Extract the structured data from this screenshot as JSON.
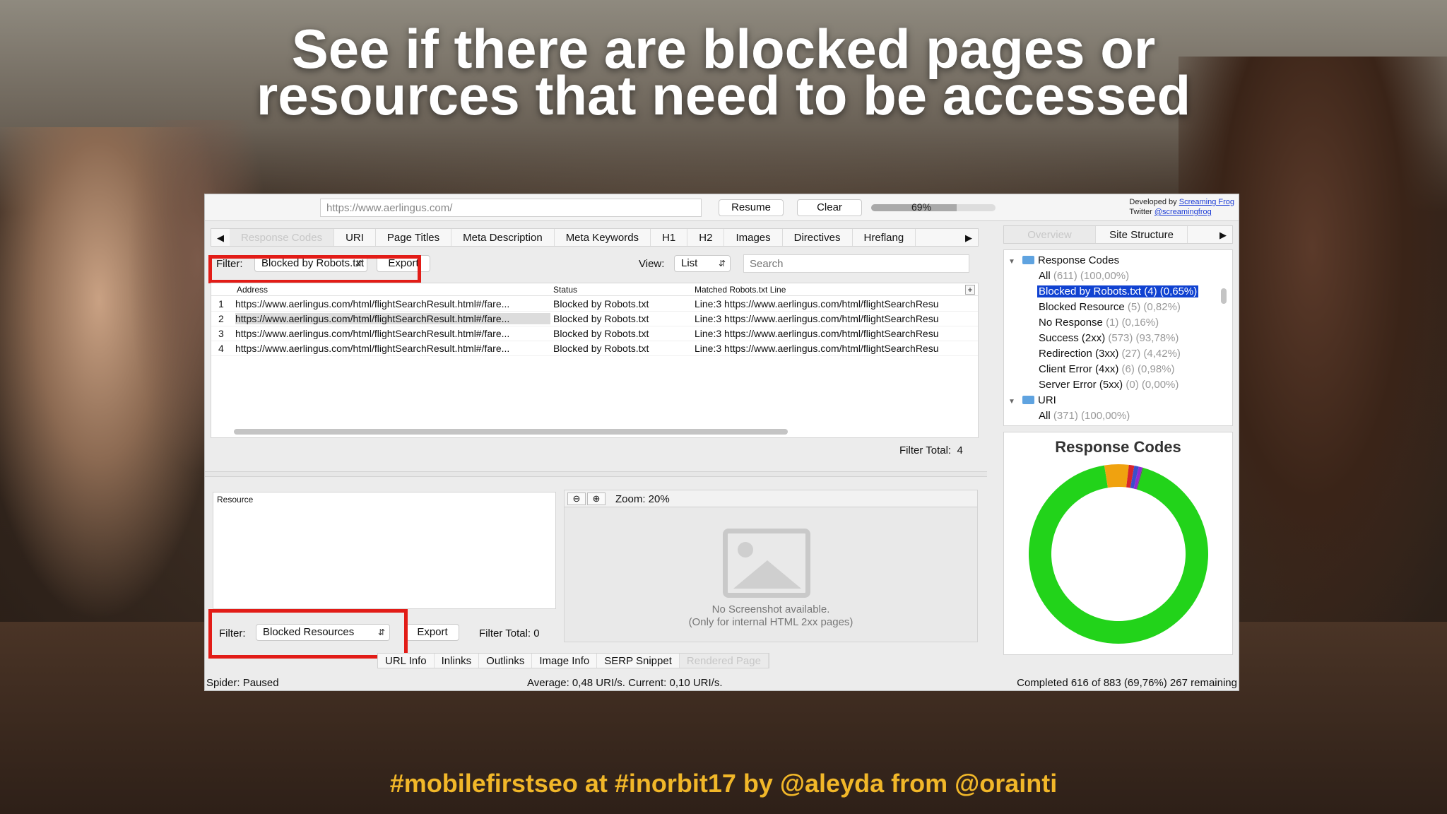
{
  "slide": {
    "headline_line1": "See if there are blocked pages or",
    "headline_line2": "resources that need to be accessed",
    "footer": "#mobilefirstseo at #inorbit17 by @aleyda from @orainti"
  },
  "toolbar": {
    "url_value": "https://www.aerlingus.com/",
    "resume_label": "Resume",
    "clear_label": "Clear",
    "progress_label": "69%",
    "progress_fraction": 0.69,
    "developed_by_prefix": "Developed by ",
    "developed_by_link": "Screaming Frog",
    "twitter_prefix": "Twitter ",
    "twitter_link": "@screamingfrog"
  },
  "tabs": {
    "prev_icon": "◀",
    "next_icon": "▶",
    "items": [
      "Response Codes",
      "URI",
      "Page Titles",
      "Meta Description",
      "Meta Keywords",
      "H1",
      "H2",
      "Images",
      "Directives",
      "Hreflang"
    ]
  },
  "filter": {
    "label": "Filter:",
    "value": "Blocked by Robots.txt",
    "export_label": "Export",
    "view_label": "View:",
    "view_value": "List",
    "search_placeholder": "Search"
  },
  "table": {
    "columns": [
      "Address",
      "Status",
      "Matched Robots.txt Line"
    ],
    "rows": [
      {
        "n": "1",
        "address": "https://www.aerlingus.com/html/flightSearchResult.html#/fare...",
        "status": "Blocked by Robots.txt",
        "line": "Line:3  https://www.aerlingus.com/html/flightSearchResu"
      },
      {
        "n": "2",
        "address": "https://www.aerlingus.com/html/flightSearchResult.html#/fare...",
        "status": "Blocked by Robots.txt",
        "line": "Line:3  https://www.aerlingus.com/html/flightSearchResu"
      },
      {
        "n": "3",
        "address": "https://www.aerlingus.com/html/flightSearchResult.html#/fare...",
        "status": "Blocked by Robots.txt",
        "line": "Line:3  https://www.aerlingus.com/html/flightSearchResu"
      },
      {
        "n": "4",
        "address": "https://www.aerlingus.com/html/flightSearchResult.html#/fare...",
        "status": "Blocked by Robots.txt",
        "line": "Line:3  https://www.aerlingus.com/html/flightSearchResu"
      }
    ],
    "filter_total_label": "Filter Total:",
    "filter_total_value": "4"
  },
  "lower": {
    "resource_header": "Resource",
    "filter_label": "Filter:",
    "filter_value": "Blocked Resources",
    "export_label": "Export",
    "filter_total": "Filter Total: 0",
    "zoom_label": "Zoom: 20%",
    "no_screenshot_line1": "No Screenshot available.",
    "no_screenshot_line2": "(Only for internal HTML 2xx pages)",
    "tabs": [
      "URL Info",
      "Inlinks",
      "Outlinks",
      "Image Info",
      "SERP Snippet",
      "Rendered Page"
    ]
  },
  "status": {
    "spider": "Spider: Paused",
    "average": "Average: 0,48 URI/s. Current: 0,10 URI/s.",
    "completed": "Completed 616 of 883 (69,76%) 267 remaining"
  },
  "right": {
    "tabs": [
      "Overview",
      "Site Structure"
    ],
    "tree": [
      {
        "label": "Response Codes",
        "count": "",
        "folder": true
      },
      {
        "label": "All",
        "count": "(611) (100,00%)"
      },
      {
        "label": "Blocked by Robots.txt (4) (0,65%)",
        "count": "",
        "selected": true
      },
      {
        "label": "Blocked Resource",
        "count": "(5) (0,82%)"
      },
      {
        "label": "No Response",
        "count": "(1) (0,16%)"
      },
      {
        "label": "Success (2xx)",
        "count": "(573) (93,78%)"
      },
      {
        "label": "Redirection (3xx)",
        "count": "(27) (4,42%)"
      },
      {
        "label": "Client Error (4xx)",
        "count": "(6) (0,98%)"
      },
      {
        "label": "Server Error (5xx)",
        "count": "(0) (0,00%)"
      },
      {
        "label": "URI",
        "count": "",
        "folder": true
      },
      {
        "label": "All",
        "count": "(371) (100,00%)"
      }
    ],
    "chart_title": "Response Codes"
  },
  "colors": {
    "red_highlight": "#e21c17",
    "selection_blue": "#1042d1",
    "footer_yellow": "#f1b729"
  },
  "chart_data": {
    "type": "pie",
    "donut": true,
    "title": "Response Codes",
    "categories": [
      "Success (2xx)",
      "Redirection (3xx)",
      "Client Error (4xx)",
      "Blocked Resource",
      "Blocked by Robots.txt",
      "No Response"
    ],
    "values": [
      573,
      27,
      6,
      5,
      4,
      1
    ],
    "colors": [
      "#22d31a",
      "#f0a20f",
      "#d8252b",
      "#3a4fc9",
      "#8f2ad1",
      "#5a5a5a"
    ]
  }
}
